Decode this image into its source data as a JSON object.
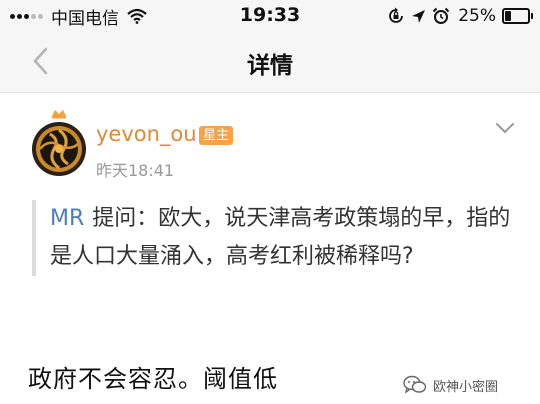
{
  "status_bar": {
    "carrier": "中国电信",
    "time": "19:33",
    "battery": "25%",
    "battery_level": 0.25,
    "icons": [
      "signal-icon",
      "wifi-icon",
      "orientation-lock-icon",
      "location-icon",
      "alarm-icon",
      "battery-icon"
    ]
  },
  "nav": {
    "title": "详情",
    "back_icon": "chevron-left-icon"
  },
  "post": {
    "username": "yevon_ou",
    "badge": "星主",
    "time": "昨天18:41",
    "more_icon": "chevron-down-icon",
    "question": {
      "asker": "MR",
      "text": "提问：欧大，说天津高考政策塌的早，指的是人口大量涌入，高考红利被稀释吗?"
    },
    "answer": "政府不会容忍。阈值低"
  },
  "watermark": {
    "text": "欧神小密圈"
  },
  "colors": {
    "username": "#e08a36",
    "badge": "#f3a34b",
    "asker": "#4a7fb5",
    "nav_background": "#f6f6f6"
  }
}
